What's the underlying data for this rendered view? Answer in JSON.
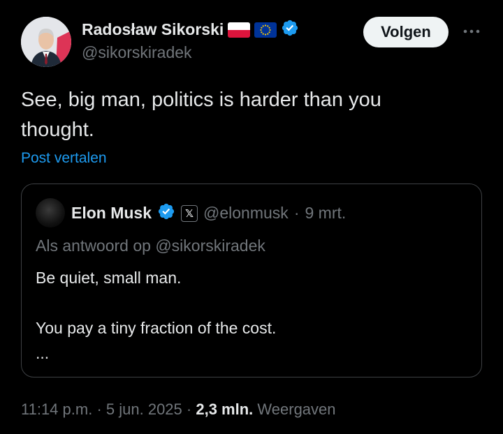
{
  "author": {
    "name": "Radosław Sikorski",
    "handle": "@sikorskiradek",
    "flags": [
      "flag-poland-icon",
      "flag-eu-icon"
    ],
    "verified_icon": "verified-badge-icon"
  },
  "actions": {
    "follow_label": "Volgen",
    "more_icon": "more-options-icon"
  },
  "tweet": {
    "text_line1": "See, big man, politics is harder than you",
    "text_line2": "thought.",
    "translate_label": "Post vertalen"
  },
  "quote": {
    "name": "Elon Musk",
    "handle": "@elonmusk",
    "separator": "·",
    "date": "9 mrt.",
    "x_badge": "𝕏",
    "reply_to": "Als antwoord op @sikorskiradek",
    "line1": "Be quiet, small man.",
    "line2": "You pay a tiny fraction of the cost.",
    "ellipsis": "..."
  },
  "footer": {
    "time": "11:14 p.m.",
    "sep1": "·",
    "date": "5 jun. 2025",
    "sep2": "·",
    "views_count": "2,3 mln.",
    "views_label": "Weergaven"
  },
  "colors": {
    "background": "#000000",
    "text": "#e7e9ea",
    "muted": "#71767b",
    "link": "#1d9bf0",
    "verified": "#1d9bf0",
    "border": "#3e4144"
  }
}
